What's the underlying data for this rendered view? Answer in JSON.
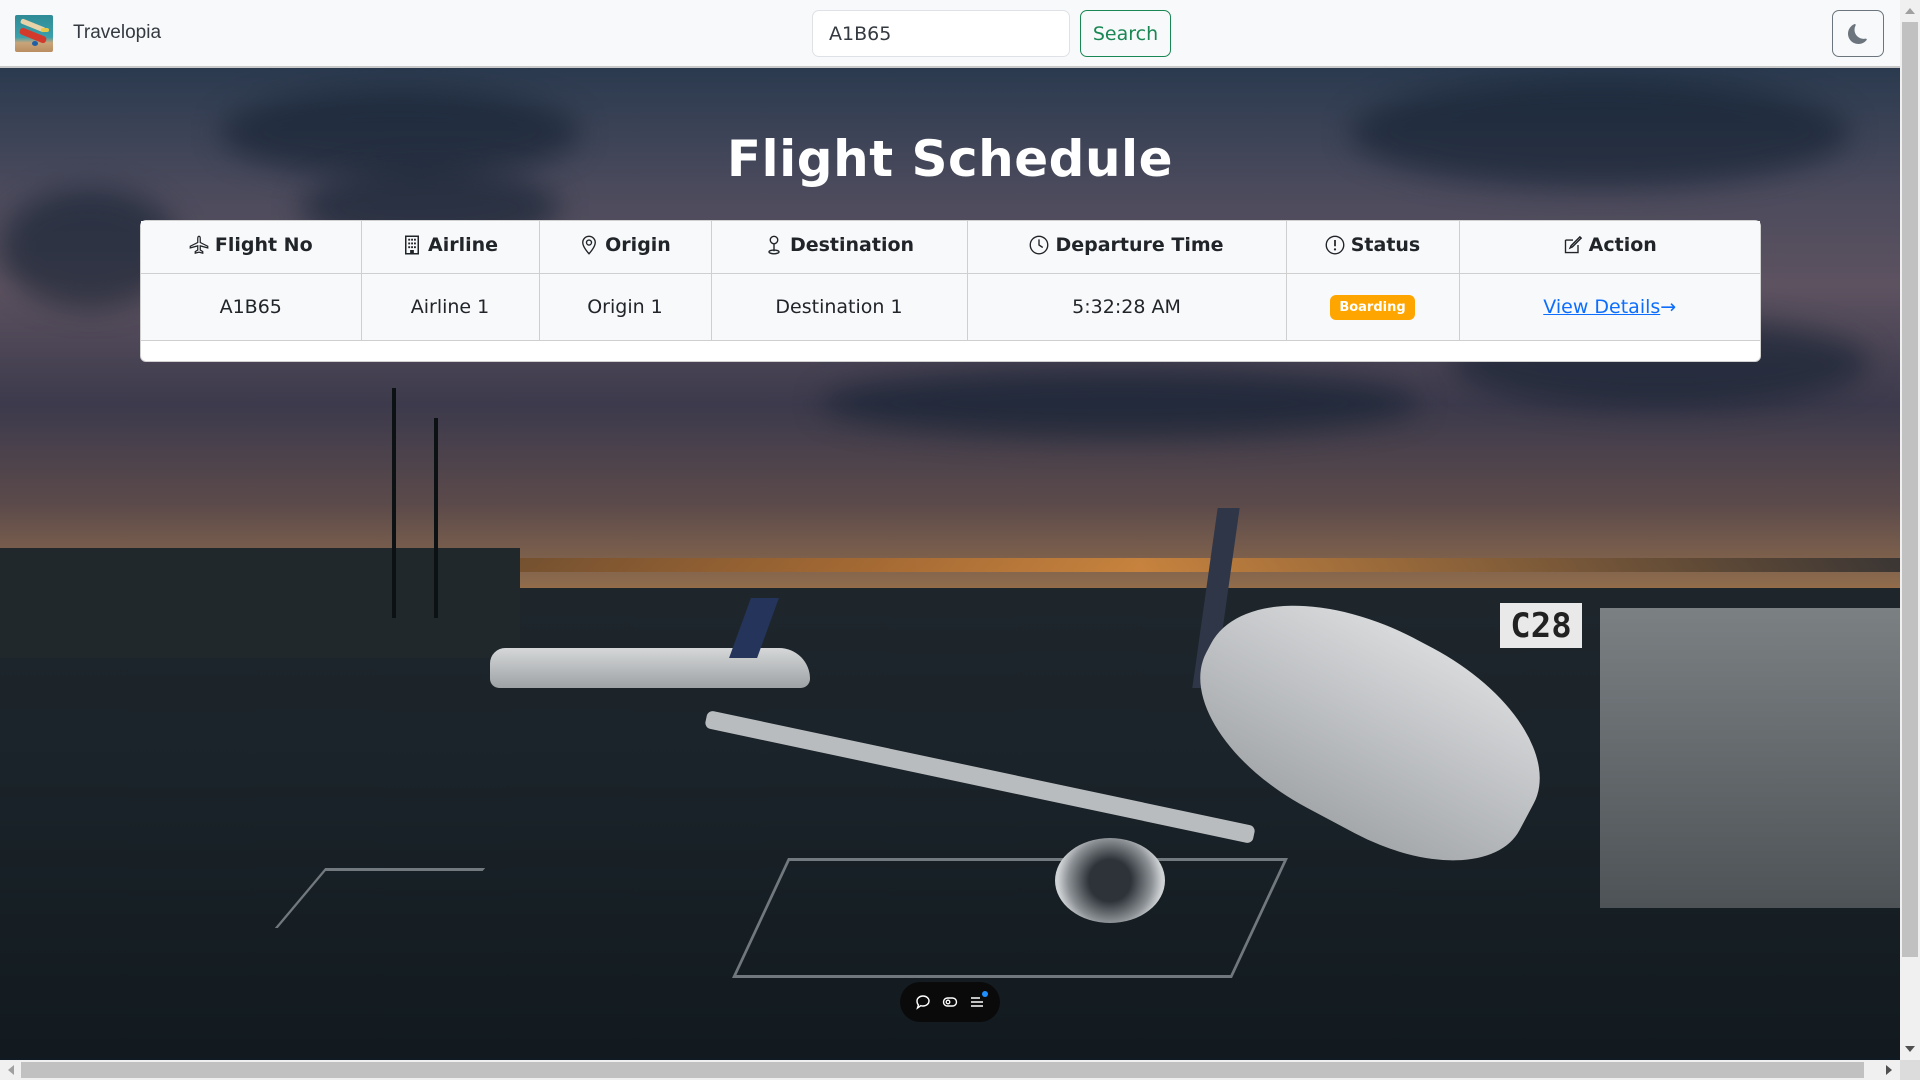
{
  "navbar": {
    "brand_name": "Travelopia",
    "logo_icon": "toy-biplane-logo",
    "search": {
      "value": "A1B65",
      "placeholder": "Search",
      "button_label": "Search"
    },
    "theme_toggle_icon": "moon-icon"
  },
  "hero": {
    "title": "Flight Schedule",
    "gate_sign": "C28"
  },
  "table": {
    "columns": [
      {
        "label": "Flight No",
        "icon": "airplane-icon"
      },
      {
        "label": "Airline",
        "icon": "building-icon"
      },
      {
        "label": "Origin",
        "icon": "geo-pin-icon"
      },
      {
        "label": "Destination",
        "icon": "map-pin-icon"
      },
      {
        "label": "Departure Time",
        "icon": "clock-icon"
      },
      {
        "label": "Status",
        "icon": "exclamation-circle-icon"
      },
      {
        "label": "Action",
        "icon": "edit-icon"
      }
    ],
    "rows": [
      {
        "flight_no": "A1B65",
        "airline": "Airline 1",
        "origin": "Origin 1",
        "destination": "Destination 1",
        "departure_time": "5:32:28 AM",
        "status": "Boarding",
        "status_color": "#ffa500",
        "action_label": "View Details",
        "action_arrow": "→"
      }
    ]
  },
  "floating_toolbar": {
    "items": [
      {
        "icon": "chat-bubble-icon"
      },
      {
        "icon": "eye-toggle-icon"
      },
      {
        "icon": "menu-notification-icon",
        "has_badge": true
      }
    ]
  },
  "colors": {
    "search_button": "#198754",
    "link": "#0d6efd",
    "status_boarding": "#ffa500"
  }
}
